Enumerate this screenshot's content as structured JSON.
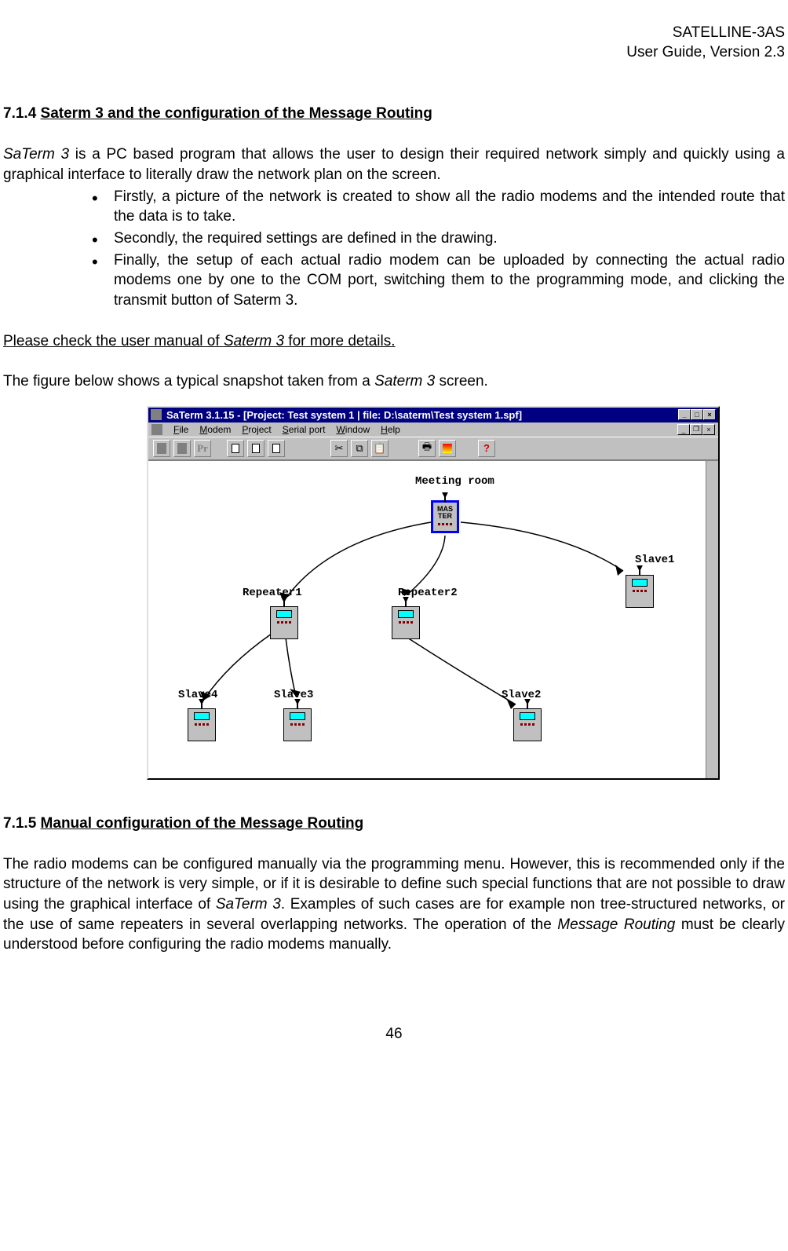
{
  "header": {
    "line1": "SATELLINE-3AS",
    "line2": "User Guide, Version 2.3"
  },
  "section1": {
    "number": "7.1.4",
    "title": "Saterm 3 and the configuration of the Message Routing",
    "intro_pre": "SaTerm 3",
    "intro_post": " is a PC based program that allows the user to design their required network simply and quickly using a graphical interface to literally draw the network plan on the screen.",
    "bullets": [
      "Firstly, a picture of the network is created to show all the radio modems and the intended route that the data is to take.",
      "Secondly, the required settings are defined in the drawing.",
      "Finally, the setup of each actual radio modem can be uploaded by connecting the actual radio modems one by one to the COM port, switching them to the programming mode, and clicking the transmit button of Saterm 3."
    ],
    "check_pre": "Please check the user manual of  ",
    "check_italic": "Saterm 3",
    "check_post": " for more details.",
    "figure_pre": "The figure below shows a typical snapshot taken from a ",
    "figure_italic": "Saterm 3",
    "figure_post": " screen."
  },
  "screenshot": {
    "title": "SaTerm 3.1.15 - [Project: Test system 1 | file: D:\\saterm\\Test system 1.spf]",
    "menu": [
      "File",
      "Modem",
      "Project",
      "Serial port",
      "Window",
      "Help"
    ],
    "toolbar_text": "Pr",
    "toolbar_icons": {
      "modem1": "modem-icon",
      "modem2": "modem-icon",
      "pr": "pr-icon",
      "doc1": "doc-icon",
      "doc2": "doc-icon",
      "doc3": "doc-icon",
      "cut": "✂",
      "copy": "⧉",
      "paste": "📋",
      "print": "🖶",
      "send": "send-icon",
      "help": "?"
    },
    "master_label": "MAS\nTER",
    "nodes": {
      "meeting_room": "Meeting room",
      "repeater1": "Repeater1",
      "repeater2": "Repeater2",
      "slave1": "Slave1",
      "slave2": "Slave2",
      "slave3": "Slave3",
      "slave4": "Slave4"
    }
  },
  "section2": {
    "number": "7.1.5",
    "title": "Manual configuration of the Message Routing",
    "body_parts": [
      "The radio modems can be configured manually via the programming menu. However, this is recommended only if the structure of the network is very simple, or if it is desirable to define such special functions that are not possible to draw using the graphical interface of ",
      "SaTerm 3",
      ". Examples of such cases are for example non tree-structured networks, or the use of same repeaters in several overlapping networks. The operation of the ",
      "Message Routing",
      " must be clearly understood before configuring the radio modems manually."
    ]
  },
  "page_number": "46"
}
